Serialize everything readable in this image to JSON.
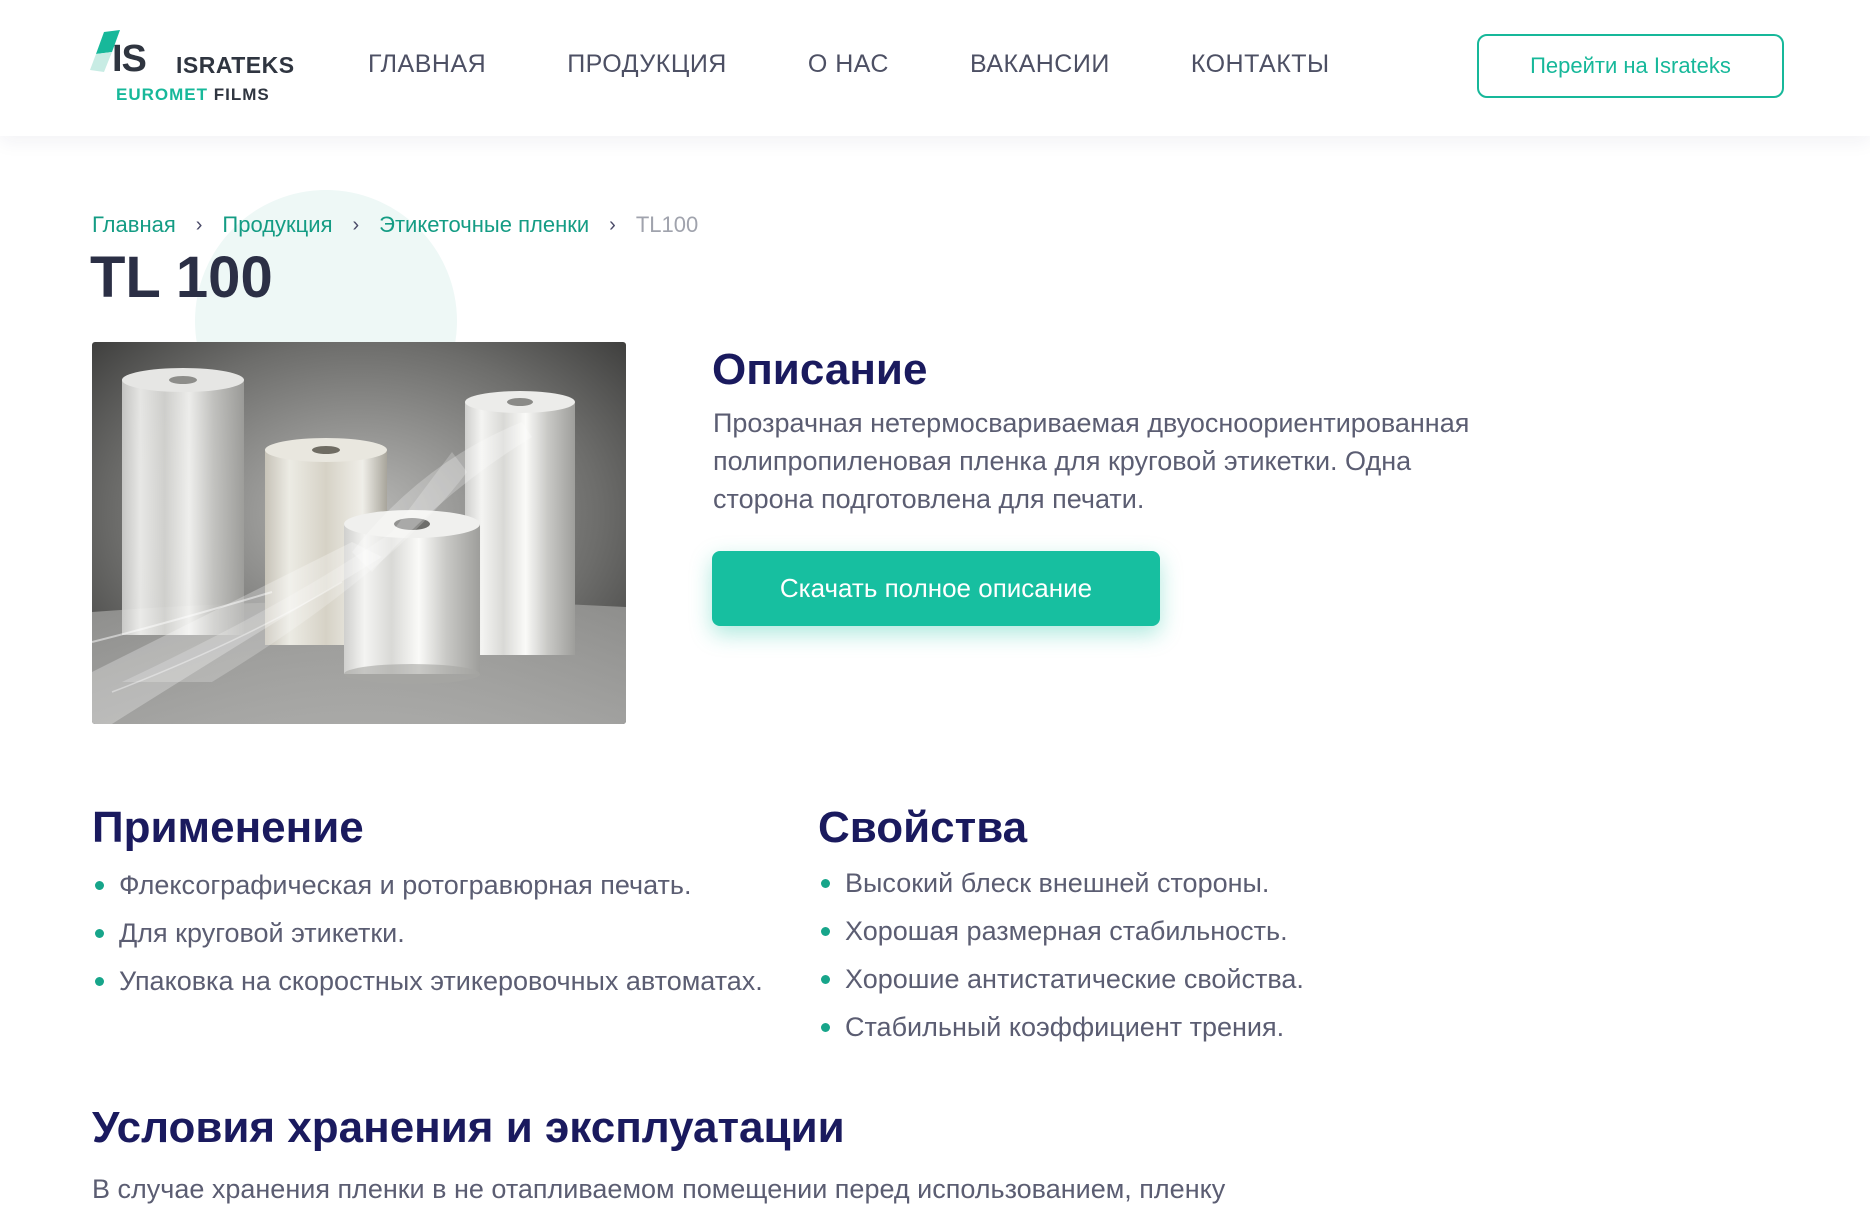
{
  "header": {
    "logo": {
      "mark": "IS",
      "name": "ISRATEKS",
      "sub_green": "EUROMET",
      "sub_dark": "FILMS"
    },
    "nav": [
      "ГЛАВНАЯ",
      "ПРОДУКЦИЯ",
      "О НАС",
      "ВАКАНСИИ",
      "КОНТАКТЫ"
    ],
    "cta_label": "Перейти на Israteks",
    "accent_color": "#17b89a"
  },
  "breadcrumb": {
    "items": [
      "Главная",
      "Продукция",
      "Этикеточные пленки"
    ],
    "current": "TL100",
    "separator": "›"
  },
  "page_title": "TL 100",
  "description": {
    "title": "Описание",
    "lines": [
      "Прозрачная нетермосвариваемая двуосноориентированная",
      "полипропиленовая пленка для круговой этикетки. Одна",
      "сторона подготовлена для печати."
    ],
    "download_label": "Скачать полное описание"
  },
  "application": {
    "title": "Применение",
    "items": [
      "Флексографическая и ротогравюрная печать.",
      "Для круговой этикетки.",
      "Упаковка на скоростных этикеровочных автоматах."
    ]
  },
  "properties": {
    "title": "Свойства",
    "items": [
      "Высокий блеск внешней стороны.",
      "Хорошая размерная стабильность.",
      "Хорошие антистатические свойства.",
      "Стабильный коэффициент трения."
    ]
  },
  "storage": {
    "title": "Условия хранения и эксплуатации",
    "text": "В случае хранения пленки в не отапливаемом помещении перед использованием, пленку"
  }
}
